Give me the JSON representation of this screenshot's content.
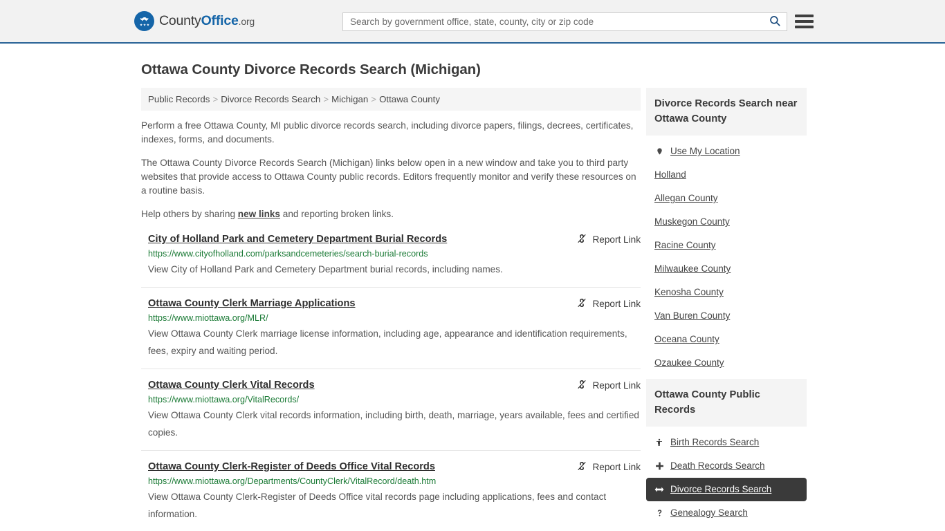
{
  "header": {
    "logo": {
      "part_a": "County",
      "part_b": "Office",
      "part_org": ".org",
      "icon": "eagle-shield-icon"
    },
    "search": {
      "placeholder": "Search by government office, state, county, city or zip code",
      "value": "",
      "search_icon": "search-icon"
    },
    "menu_icon": "hamburger-menu-icon"
  },
  "page": {
    "title": "Ottawa County Divorce Records Search (Michigan)"
  },
  "breadcrumb": {
    "separator": ">",
    "items": [
      {
        "label": "Public Records"
      },
      {
        "label": "Divorce Records Search"
      },
      {
        "label": "Michigan"
      },
      {
        "label": "Ottawa County"
      }
    ]
  },
  "intro": {
    "paragraph1": "Perform a free Ottawa County, MI public divorce records search, including divorce papers, filings, decrees, certificates, indexes, forms, and documents.",
    "paragraph2": "The Ottawa County Divorce Records Search (Michigan) links below open in a new window and take you to third party websites that provide access to Ottawa County public records. Editors frequently monitor and verify these resources on a routine basis.",
    "help_prefix": "Help others by sharing ",
    "help_link": "new links",
    "help_suffix": " and reporting broken links."
  },
  "results": {
    "report_label": "Report Link",
    "report_icon": "broken-link-icon",
    "items": [
      {
        "title": "City of Holland Park and Cemetery Department Burial Records",
        "url": "https://www.cityofholland.com/parksandcemeteries/search-burial-records",
        "description": "View City of Holland Park and Cemetery Department burial records, including names."
      },
      {
        "title": "Ottawa County Clerk Marriage Applications",
        "url": "https://www.miottawa.org/MLR/",
        "description": "View Ottawa County Clerk marriage license information, including age, appearance and identification requirements, fees, expiry and waiting period."
      },
      {
        "title": "Ottawa County Clerk Vital Records",
        "url": "https://www.miottawa.org/VitalRecords/",
        "description": "View Ottawa County Clerk vital records information, including birth, death, marriage, years available, fees and certified copies."
      },
      {
        "title": "Ottawa County Clerk-Register of Deeds Office Vital Records",
        "url": "https://www.miottawa.org/Departments/CountyClerk/VitalRecord/death.htm",
        "description": "View Ottawa County Clerk-Register of Deeds Office vital records page including applications, fees and contact information."
      }
    ]
  },
  "sidebar": {
    "nearby": {
      "heading": "Divorce Records Search near Ottawa County",
      "items": [
        {
          "label": "Use My Location",
          "icon": "map-pin-icon",
          "active": false
        },
        {
          "label": "Holland",
          "icon": "",
          "active": false
        },
        {
          "label": "Allegan County",
          "icon": "",
          "active": false
        },
        {
          "label": "Muskegon County",
          "icon": "",
          "active": false
        },
        {
          "label": "Racine County",
          "icon": "",
          "active": false
        },
        {
          "label": "Milwaukee County",
          "icon": "",
          "active": false
        },
        {
          "label": "Kenosha County",
          "icon": "",
          "active": false
        },
        {
          "label": "Van Buren County",
          "icon": "",
          "active": false
        },
        {
          "label": "Oceana County",
          "icon": "",
          "active": false
        },
        {
          "label": "Ozaukee County",
          "icon": "",
          "active": false
        }
      ]
    },
    "public_records": {
      "heading": "Ottawa County Public Records",
      "items": [
        {
          "label": "Birth Records Search",
          "icon": "baby-person-icon",
          "active": false
        },
        {
          "label": "Death Records Search",
          "icon": "cross-plus-icon",
          "active": false
        },
        {
          "label": "Divorce Records Search",
          "icon": "left-right-arrow-icon",
          "active": true
        },
        {
          "label": "Genealogy Search",
          "icon": "question-mark-icon",
          "active": false
        }
      ]
    }
  },
  "colors": {
    "header_bg": "#f2f2f2",
    "header_border": "#2a6496",
    "brand_blue": "#1565a8",
    "url_green": "#1a7a35",
    "active_bg": "#3a3a3a"
  }
}
